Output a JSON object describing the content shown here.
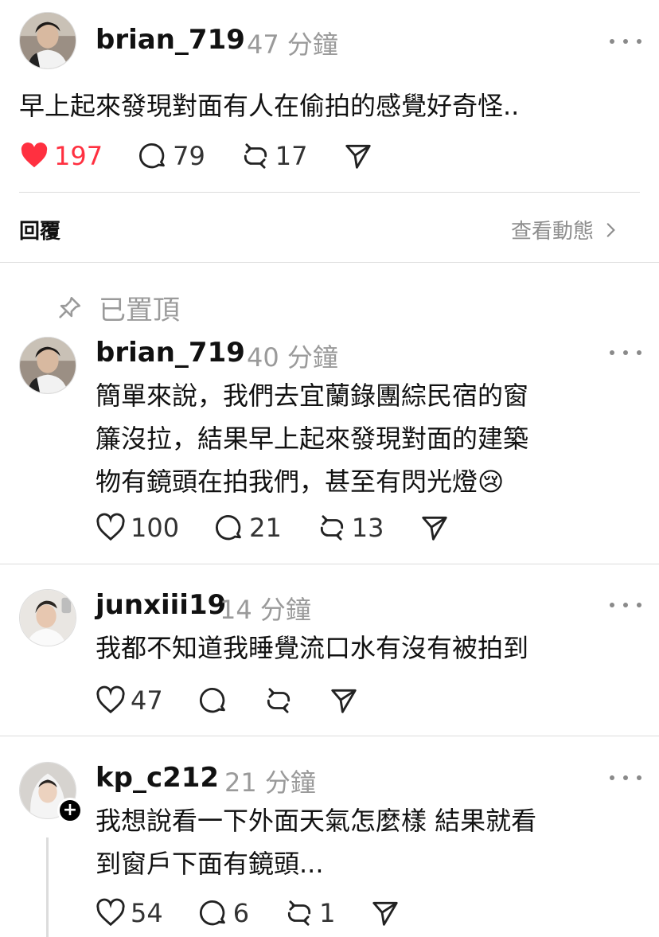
{
  "post": {
    "username": "brian_719",
    "time": "47 分鐘",
    "text": "早上起來發現對面有人在偷拍的感覺好奇怪..",
    "likes": "197",
    "comments": "79",
    "reposts": "17"
  },
  "reply_bar": {
    "label": "回覆",
    "view_activity": "查看動態"
  },
  "pinned_label": "已置頂",
  "replies": [
    {
      "username": "brian_719",
      "time": "40 分鐘",
      "lines": [
        "簡單來說，我們去宜蘭錄團綜民宿的窗",
        "簾沒拉，結果早上起來發現對面的建築",
        "物有鏡頭在拍我們，甚至有閃光燈😢"
      ],
      "likes": "100",
      "comments": "21",
      "reposts": "13"
    },
    {
      "username": "junxiii19",
      "time": "14 分鐘",
      "lines": [
        "我都不知道我睡覺流口水有沒有被拍到"
      ],
      "likes": "47"
    },
    {
      "username": "kp_c212",
      "time": "21 分鐘",
      "lines": [
        "我想說看一下外面天氣怎麼樣 結果就看",
        "到窗戶下面有鏡頭..."
      ],
      "likes": "54",
      "comments": "6",
      "reposts": "1"
    }
  ],
  "icons": {
    "like": "heart-icon",
    "comment": "comment-bubble-icon",
    "repost": "repost-icon",
    "share": "send-icon",
    "more": "more-dots-icon",
    "pin": "pin-icon",
    "chevron": "chevron-right-icon",
    "follow": "plus-icon"
  },
  "colors": {
    "liked": "#ff3040",
    "muted": "#9a9a9a",
    "divider": "#dcdcdc"
  }
}
